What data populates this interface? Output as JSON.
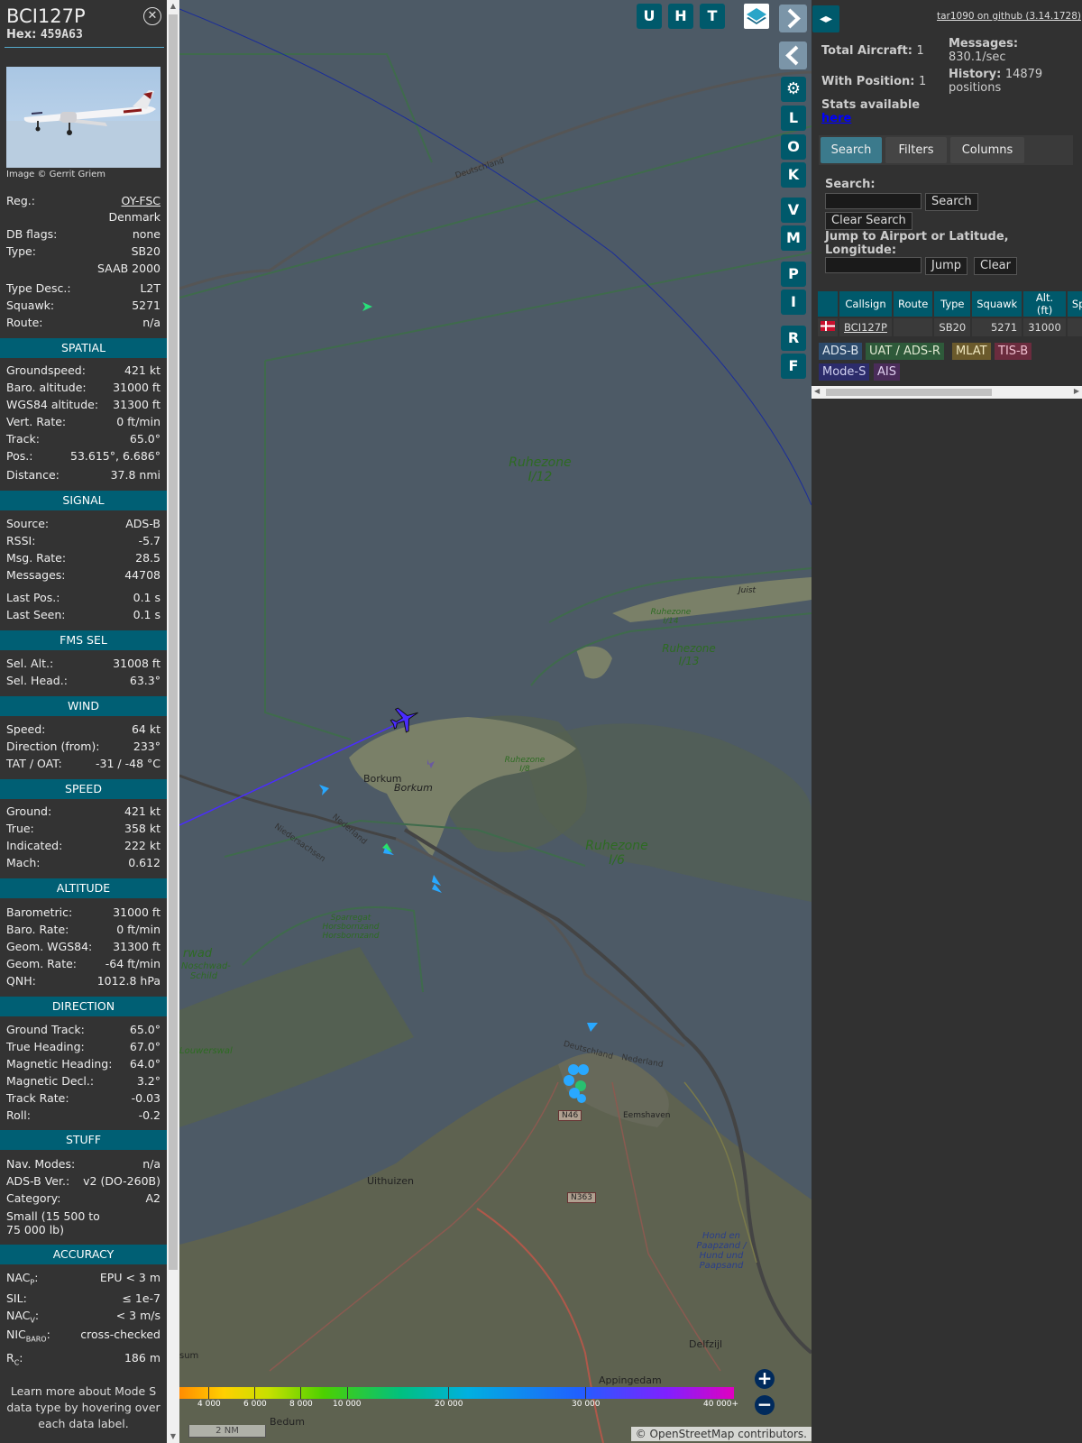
{
  "info": {
    "callsign": "BCI127P",
    "hex_label": "Hex:",
    "hex": "459A63",
    "close_icon": "close-circle-icon",
    "photo_credit": "Image © Gerrit Griem",
    "top_rows": [
      {
        "k": "Reg.:",
        "v": "OY-FSC"
      },
      {
        "k": "",
        "v": "Denmark"
      },
      {
        "k": "DB flags:",
        "v": "none"
      },
      {
        "k": "Type:",
        "v": "SB20"
      },
      {
        "k": "",
        "v": "SAAB 2000"
      },
      {
        "k": "Type Desc.:",
        "v": "L2T"
      },
      {
        "k": "Squawk:",
        "v": "5271"
      },
      {
        "k": "Route:",
        "v": "n/a"
      }
    ],
    "sections": {
      "spatial": "SPATIAL",
      "signal": "SIGNAL",
      "fms": "FMS SEL",
      "wind": "WIND",
      "speed": "SPEED",
      "altitude": "ALTITUDE",
      "direction": "DIRECTION",
      "stuff": "STUFF",
      "accuracy": "ACCURACY"
    },
    "spatial": [
      {
        "k": "Groundspeed:",
        "v": "421 kt"
      },
      {
        "k": "Baro. altitude:",
        "v": "31000 ft"
      },
      {
        "k": "WGS84 altitude:",
        "v": "31300 ft"
      },
      {
        "k": "Vert. Rate:",
        "v": "0 ft/min"
      },
      {
        "k": "Track:",
        "v": "65.0°"
      },
      {
        "k": "Pos.:",
        "v": "53.615°, 6.686°"
      },
      {
        "k": "Distance:",
        "v": "37.8 nmi"
      }
    ],
    "signal": [
      {
        "k": "Source:",
        "v": "ADS-B"
      },
      {
        "k": "RSSI:",
        "v": "-5.7"
      },
      {
        "k": "Msg. Rate:",
        "v": "28.5"
      },
      {
        "k": "Messages:",
        "v": "44708"
      },
      {
        "k": "Last Pos.:",
        "v": "0.1 s"
      },
      {
        "k": "Last Seen:",
        "v": "0.1 s"
      }
    ],
    "fms": [
      {
        "k": "Sel. Alt.:",
        "v": "31008 ft"
      },
      {
        "k": "Sel. Head.:",
        "v": "63.3°"
      }
    ],
    "wind": [
      {
        "k": "Speed:",
        "v": "64 kt"
      },
      {
        "k": "Direction (from):",
        "v": "233°"
      },
      {
        "k": "TAT / OAT:",
        "v": "-31 / -48 °C"
      }
    ],
    "speed": [
      {
        "k": "Ground:",
        "v": "421 kt"
      },
      {
        "k": "True:",
        "v": "358 kt"
      },
      {
        "k": "Indicated:",
        "v": "222 kt"
      },
      {
        "k": "Mach:",
        "v": "0.612"
      }
    ],
    "altitude": [
      {
        "k": "Barometric:",
        "v": "31000 ft"
      },
      {
        "k": "Baro. Rate:",
        "v": "0 ft/min"
      },
      {
        "k": "Geom. WGS84:",
        "v": "31300 ft"
      },
      {
        "k": "Geom. Rate:",
        "v": "-64 ft/min"
      },
      {
        "k": "QNH:",
        "v": "1012.8 hPa"
      }
    ],
    "direction": [
      {
        "k": "Ground Track:",
        "v": "65.0°"
      },
      {
        "k": "True Heading:",
        "v": "67.0°"
      },
      {
        "k": "Magnetic Heading:",
        "v": "64.0°"
      },
      {
        "k": "Magnetic Decl.:",
        "v": "3.2°"
      },
      {
        "k": "Track Rate:",
        "v": "-0.03"
      },
      {
        "k": "Roll:",
        "v": "-0.2"
      }
    ],
    "stuff": [
      {
        "k": "Nav. Modes:",
        "v": "n/a"
      },
      {
        "k": "ADS-B Ver.:",
        "v": "v2 (DO-260B)"
      },
      {
        "k": "Category:",
        "v": "A2"
      }
    ],
    "category_desc": "Small (15 500 to 75 000 lb)",
    "accuracy": {
      "nacp_k": "NAC",
      "nacp_sub": "P",
      "nacp_v": "EPU < 3 m",
      "sil_k": "SIL:",
      "sil_v": "≤ 1e-7",
      "nacv_k": "NAC",
      "nacv_sub": "V",
      "nacv_v": "< 3 m/s",
      "nic_k": "NIC",
      "nic_sub": "BARO",
      "nic_v": "cross-checked",
      "rc_k": "R",
      "rc_sub": "C",
      "rc_v": "186 m"
    },
    "learn_more": "Learn more about Mode S data type by hovering over each data label."
  },
  "map": {
    "buttons_top": [
      "U",
      "H",
      "T"
    ],
    "layers_icon": "layers-icon",
    "side_buttons": [
      "L",
      "O",
      "K",
      "V",
      "M",
      "P",
      "I",
      "R",
      "F"
    ],
    "expand_icon": "chevron-right-icon",
    "collapse_icon": "chevron-left-icon",
    "settings_icon": "gear-icon",
    "zoom_in": "+",
    "zoom_out": "−",
    "labels": {
      "ruhezone_i12": "Ruhezone I/12",
      "ruhezone_i6": "Ruhezone I/6",
      "ruhezone_i13": "Ruhezone I/13",
      "ruhezone_i14": "Ruhezone I/14",
      "ruhezone_i8": "Ruhezone I/8",
      "sparregat": "Sparregat Horsbornzand Horsbornzand",
      "borkum": "Borkum",
      "borkum2": "Borkum",
      "juist": "Juist",
      "deutschland1": "Deutschland",
      "deutschland2": "Deutschland",
      "nederland1": "Nederland",
      "nederland2": "Nederland",
      "niedersachsen": "Niedersachsen",
      "eemshaven": "Eemshaven",
      "uithuizen": "Uithuizen",
      "n46": "N46",
      "n363": "N363",
      "delfzijl": "Delfzijl",
      "appingedam": "Appingedam",
      "bedum": "Bedum",
      "hond": "Hond en Paapzand / Hund und Paapsand",
      "rwad": "rwad",
      "schild": "Noschwad-Schild",
      "louwerswal": "Louwerswal",
      "sum": "sum"
    },
    "alt_ticks": [
      "4 000",
      "6 000",
      "8 000",
      "10 000",
      "20 000",
      "30 000",
      "40 000+"
    ],
    "scale_label": "2 NM",
    "attribution_symbol": "©",
    "attribution_link": "OpenStreetMap",
    "attribution_text": " contributors."
  },
  "panel": {
    "toggle_icon": "left-right-arrows-icon",
    "github": "tar1090 on github (3.14.1728)",
    "total_label": "Total Aircraft:",
    "total_value": "1",
    "with_pos_label": "With Position:",
    "with_pos_value": "1",
    "messages_label": "Messages:",
    "messages_value": "830.1/sec",
    "history_label": "History:",
    "history_value": "14879 positions",
    "stats_text": "Stats available",
    "stats_link": "here",
    "tabs": [
      "Search",
      "Filters",
      "Columns"
    ],
    "search_label": "Search:",
    "search_button": "Search",
    "clear_search_button": "Clear Search",
    "jump_label": "Jump to Airport or Latitude, Longitude:",
    "jump_button": "Jump",
    "clear_button": "Clear",
    "table": {
      "headers": [
        "",
        "Callsign",
        "Route",
        "Type",
        "Squawk",
        "Alt. (ft)",
        "Spd."
      ],
      "row": {
        "flag_icon": "denmark-flag-icon",
        "callsign": "BCI127P",
        "route": "",
        "type": "SB20",
        "squawk": "5271",
        "alt": "31000",
        "spd": ""
      }
    },
    "legend": [
      {
        "label": "ADS-B",
        "bg": "#2c4a6b",
        "fg": "#dfe8f0"
      },
      {
        "label": "UAT / ADS-R",
        "bg": "#2e5a3a",
        "fg": "#dfe8d0"
      },
      {
        "label": "MLAT",
        "bg": "#6b5a2c",
        "fg": "#f0e8c0"
      },
      {
        "label": "TIS-B",
        "bg": "#6b2c3e",
        "fg": "#f0c0d0"
      },
      {
        "label": "Mode-S",
        "bg": "#2c2c6b",
        "fg": "#d0d0f0"
      },
      {
        "label": "AIS",
        "bg": "#4a2c5a",
        "fg": "#e0d0f0"
      }
    ]
  }
}
